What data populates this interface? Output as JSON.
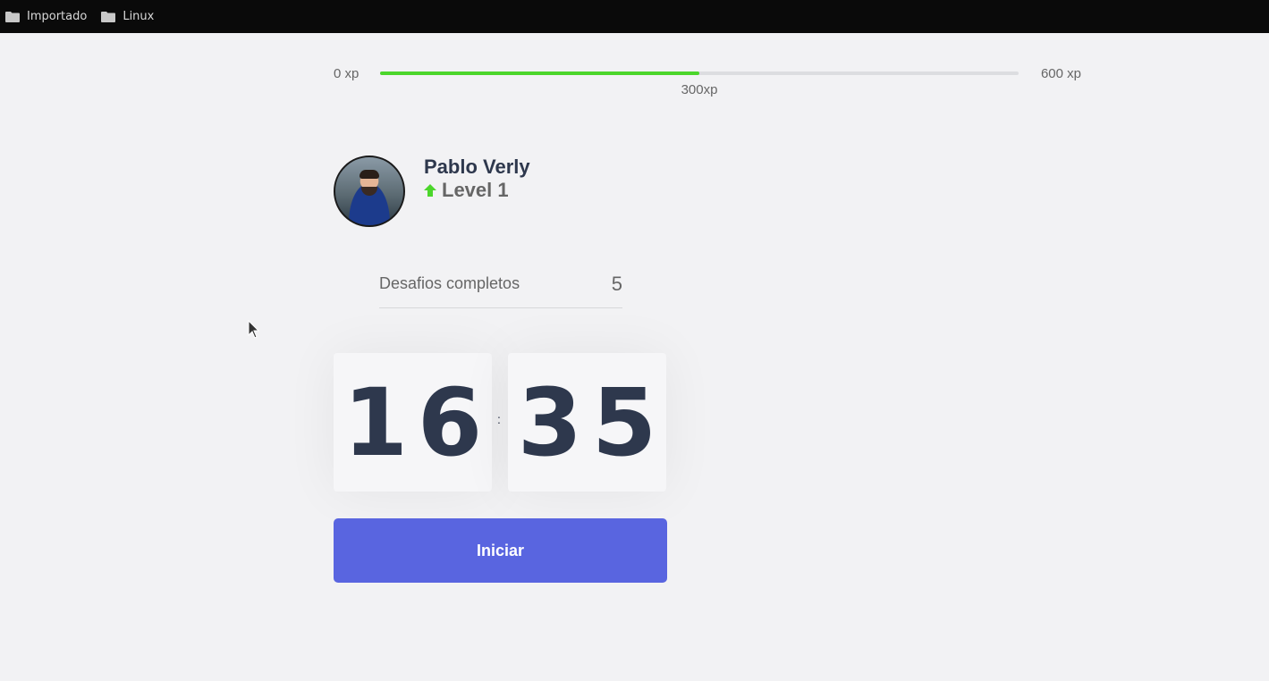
{
  "bookmarks": [
    {
      "label": "Importado",
      "icon": "folder-icon"
    },
    {
      "label": "Linux",
      "icon": "folder-icon"
    }
  ],
  "experience": {
    "min_label": "0 xp",
    "max_label": "600 xp",
    "current_label": "300xp",
    "current": 300,
    "max": 600,
    "bar_color": "#4cd62b"
  },
  "profile": {
    "name": "Pablo Verly",
    "level_label": "Level 1",
    "level_icon": "level-up-arrow-icon"
  },
  "challenges": {
    "label": "Desafios completos",
    "count": "5"
  },
  "countdown": {
    "minute_left": "1",
    "minute_right": "6",
    "separator": ":",
    "second_left": "3",
    "second_right": "5"
  },
  "start_button": {
    "label": "Iniciar",
    "color": "#5965e0"
  }
}
